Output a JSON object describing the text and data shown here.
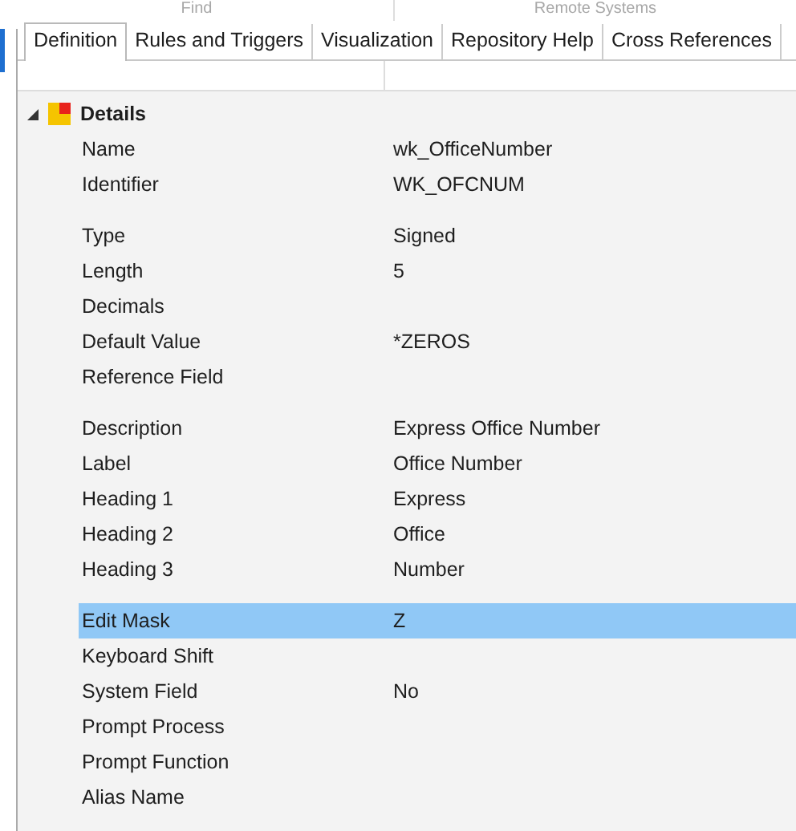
{
  "top_sections": [
    "Find",
    "Remote Systems"
  ],
  "tabs": [
    {
      "label": "Definition",
      "selected": true
    },
    {
      "label": "Rules and Triggers",
      "selected": false
    },
    {
      "label": "Visualization",
      "selected": false
    },
    {
      "label": "Repository Help",
      "selected": false
    },
    {
      "label": "Cross References",
      "selected": false
    }
  ],
  "section": {
    "title": "Details",
    "expanded": true,
    "groups": [
      [
        {
          "label": "Name",
          "value": "wk_OfficeNumber",
          "selected": false
        },
        {
          "label": "Identifier",
          "value": "WK_OFCNUM",
          "selected": false
        }
      ],
      [
        {
          "label": "Type",
          "value": "Signed",
          "selected": false
        },
        {
          "label": "Length",
          "value": "5",
          "selected": false
        },
        {
          "label": "Decimals",
          "selected": false
        },
        {
          "label": "Default Value",
          "value": "*ZEROS",
          "selected": false
        },
        {
          "label": "Reference Field",
          "selected": false
        }
      ],
      [
        {
          "label": "Description",
          "value": "Express Office Number",
          "selected": false
        },
        {
          "label": "Label",
          "value": "Office Number",
          "selected": false
        },
        {
          "label": "Heading 1",
          "value": "Express",
          "selected": false
        },
        {
          "label": "Heading 2",
          "value": "Office",
          "selected": false
        },
        {
          "label": "Heading 3",
          "value": "Number",
          "selected": false
        }
      ],
      [
        {
          "label": "Edit Mask",
          "value": "Z",
          "selected": true
        },
        {
          "label": "Keyboard Shift",
          "selected": false
        },
        {
          "label": "System Field",
          "value": "No",
          "selected": false
        },
        {
          "label": "Prompt Process",
          "selected": false
        },
        {
          "label": "Prompt Function",
          "selected": false
        },
        {
          "label": "Alias Name",
          "selected": false
        }
      ]
    ]
  }
}
